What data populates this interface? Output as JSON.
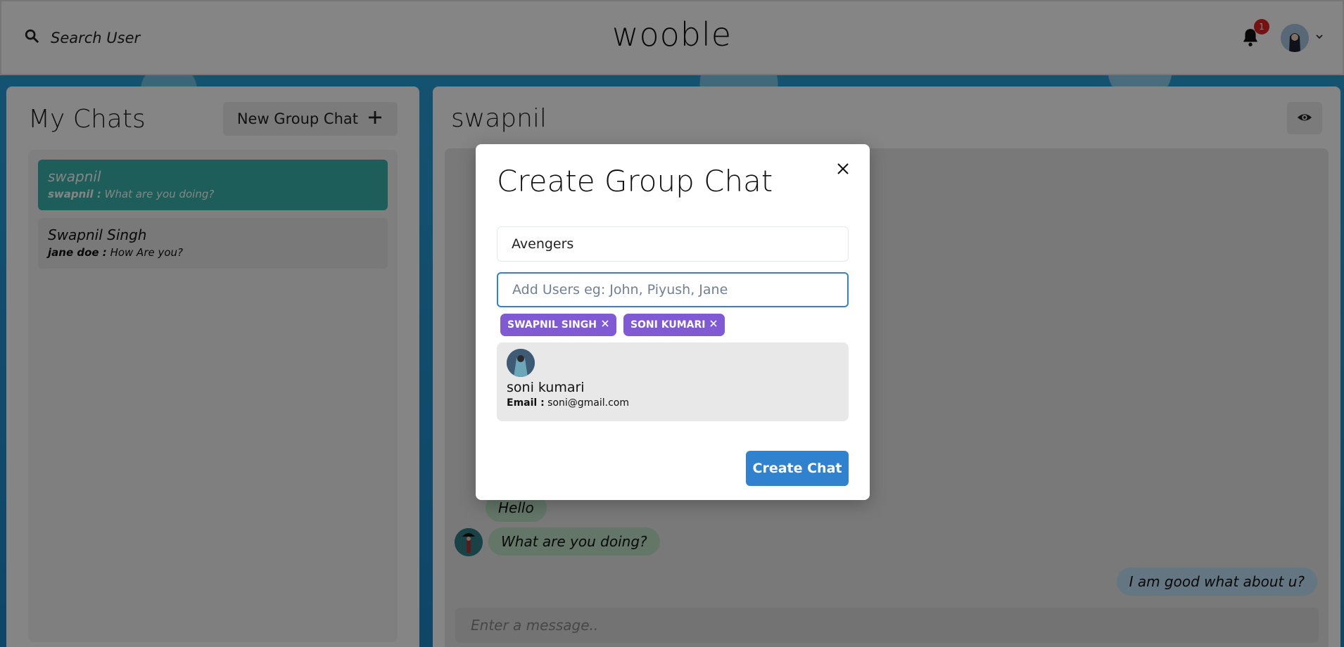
{
  "header": {
    "search_label": "Search User",
    "logo_text": "wooble",
    "notification_count": "1"
  },
  "sidebar": {
    "title": "My Chats",
    "new_group_label": "New Group Chat",
    "chats": [
      {
        "name": "swapnil",
        "sender": "swapnil :",
        "preview": "What are you doing?",
        "active": true
      },
      {
        "name": "Swapnil Singh",
        "sender": "jane doe :",
        "preview": "How Are you?",
        "active": false
      }
    ]
  },
  "chat": {
    "title": "swapnil",
    "messages": [
      {
        "text": "Hello",
        "side": "left",
        "color": "#bee3c8"
      },
      {
        "text": "What are you doing?",
        "side": "left",
        "color": "#bee3c8"
      },
      {
        "text": "I am good what about u?",
        "side": "right",
        "color": "#bee3f8"
      }
    ],
    "input_placeholder": "Enter a message.."
  },
  "modal": {
    "title": "Create Group Chat",
    "chat_name_value": "Avengers",
    "users_placeholder": "Add Users eg: John, Piyush, Jane",
    "selected_users": [
      "SWAPNIL SINGH",
      "SONI KUMARI"
    ],
    "search_result": {
      "name": "soni kumari",
      "email_label": "Email :",
      "email": "soni@gmail.com"
    },
    "create_label": "Create Chat"
  },
  "colors": {
    "accent": "#3182ce",
    "tag": "#805ad5",
    "active_chat": "#38b2ac",
    "badge": "#e02424"
  }
}
